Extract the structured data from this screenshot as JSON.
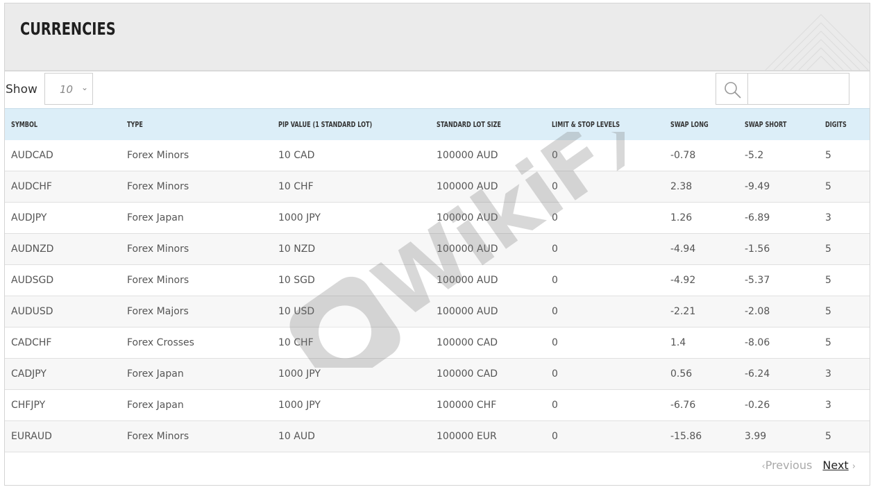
{
  "page": {
    "title": "CURRENCIES"
  },
  "controls": {
    "show_label": "Show",
    "page_size": "10",
    "search_placeholder": ""
  },
  "table": {
    "columns": [
      "SYMBOL",
      "TYPE",
      "PIP VALUE (1 STANDARD LOT)",
      "STANDARD LOT SIZE",
      "LIMIT & STOP LEVELS",
      "SWAP LONG",
      "SWAP SHORT",
      "DIGITS"
    ],
    "rows": [
      [
        "AUDCAD",
        "Forex Minors",
        "10 CAD",
        "100000 AUD",
        "0",
        "-0.78",
        "-5.2",
        "5"
      ],
      [
        "AUDCHF",
        "Forex Minors",
        "10 CHF",
        "100000 AUD",
        "0",
        "2.38",
        "-9.49",
        "5"
      ],
      [
        "AUDJPY",
        "Forex Japan",
        "1000 JPY",
        "100000 AUD",
        "0",
        "1.26",
        "-6.89",
        "3"
      ],
      [
        "AUDNZD",
        "Forex Minors",
        "10 NZD",
        "100000 AUD",
        "0",
        "-4.94",
        "-1.56",
        "5"
      ],
      [
        "AUDSGD",
        "Forex Minors",
        "10 SGD",
        "100000 AUD",
        "0",
        "-4.92",
        "-5.37",
        "5"
      ],
      [
        "AUDUSD",
        "Forex Majors",
        "10 USD",
        "100000 AUD",
        "0",
        "-2.21",
        "-2.08",
        "5"
      ],
      [
        "CADCHF",
        "Forex Crosses",
        "10 CHF",
        "100000 CAD",
        "0",
        "1.4",
        "-8.06",
        "5"
      ],
      [
        "CADJPY",
        "Forex Japan",
        "1000 JPY",
        "100000 CAD",
        "0",
        "0.56",
        "-6.24",
        "3"
      ],
      [
        "CHFJPY",
        "Forex Japan",
        "1000 JPY",
        "100000 CHF",
        "0",
        "-6.76",
        "-0.26",
        "3"
      ],
      [
        "EURAUD",
        "Forex Minors",
        "10 AUD",
        "100000 EUR",
        "0",
        "-15.86",
        "3.99",
        "5"
      ]
    ]
  },
  "pagination": {
    "previous_label": "Previous",
    "next_label": "Next"
  },
  "watermark": {
    "text": "WikiFX"
  },
  "icons": {
    "search": "search-icon",
    "dropdown": "chevron-down-icon"
  }
}
